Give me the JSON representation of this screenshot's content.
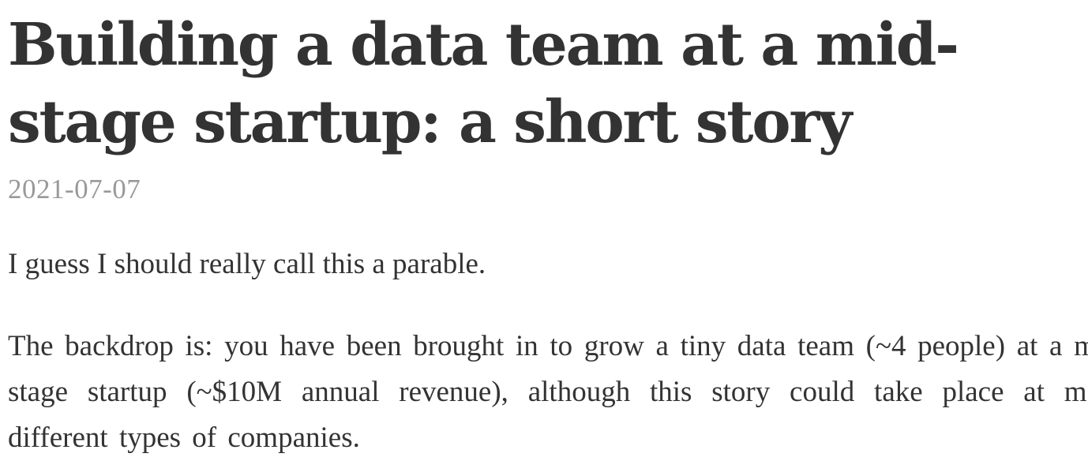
{
  "article": {
    "title": "Building a data team at a mid-stage startup: a short story",
    "date": "2021-07-07",
    "paragraphs": [
      "I guess I should really call this a parable.",
      "The backdrop is: you have been brought in to grow a tiny data team (~4 people) at a mid-stage startup (~$10M annual revenue), although this story could take place at many different types of companies."
    ]
  }
}
